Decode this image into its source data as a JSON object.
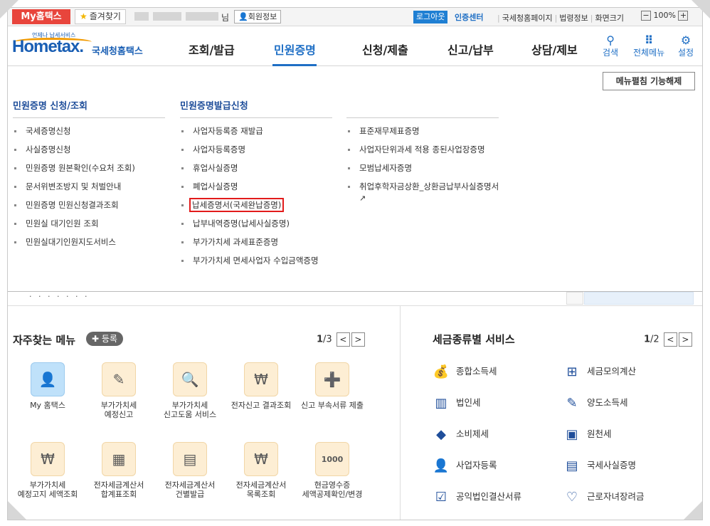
{
  "topbar": {
    "myhome": "My홈택스",
    "favorites": "즐겨찾기",
    "user_suffix": "님",
    "member_info": "회원정보",
    "logout": "로그아웃",
    "cert_center": "인증센터",
    "links": [
      "국세청홈페이지",
      "법령정보",
      "화면크기"
    ],
    "zoom_minus": "−",
    "zoom": "100%",
    "zoom_plus": "+"
  },
  "logo": {
    "small": "언제나 납세서비스",
    "home": "Hom",
    "e": "e",
    "tax": "tax.",
    "name": "국세청홈택스"
  },
  "gnb": [
    "조회/발급",
    "민원증명",
    "신청/제출",
    "신고/납부",
    "상담/제보"
  ],
  "header_icons": [
    {
      "label": "검색",
      "icon": "search-icon",
      "glyph": "🔍"
    },
    {
      "label": "전체메뉴",
      "icon": "grid-icon",
      "glyph": "⠿"
    },
    {
      "label": "설정",
      "icon": "gear-icon",
      "glyph": "⚙"
    }
  ],
  "menu_mode_button": "메뉴펼침 기능해제",
  "mega": {
    "col1": {
      "title": "민원증명 신청/조회",
      "items": [
        "국세증명신청",
        "사실증명신청",
        "민원증명 원본확인(수요처 조회)",
        "문서위변조방지 및 처벌안내",
        "민원증명 민원신청결과조회",
        "민원실 대기인원 조회",
        "민원실대기인원지도서비스"
      ]
    },
    "col2": {
      "title": "민원증명발급신청",
      "items": [
        "사업자등록증 재발급",
        "사업자등록증명",
        "휴업사실증명",
        "폐업사실증명",
        "납세증명서(국세완납증명)",
        "납부내역증명(납세사실증명)",
        "부가가치세 과세표준증명",
        "부가가치세 면세사업자 수입금액증명"
      ]
    },
    "col3": {
      "items": [
        "표준재무제표증명",
        "사업자단위과세 적용 종된사업장증명",
        "모범납세자증명",
        "취업후학자금상환_상환금납부사실증명서"
      ]
    }
  },
  "frequent": {
    "title": "자주찾는 메뉴",
    "register": "등록",
    "page_current": "1",
    "page_total": "/3",
    "prev": "<",
    "next": ">",
    "tiles": [
      {
        "line1": "My 홈택스",
        "line2": "",
        "icon": "user-icon",
        "glyph": "👤"
      },
      {
        "line1": "부가가치세",
        "line2": "예정신고",
        "icon": "vat-edit-icon",
        "glyph": "✎"
      },
      {
        "line1": "부가가치세",
        "line2": "신고도움 서비스",
        "icon": "document-search-icon",
        "glyph": "🔍"
      },
      {
        "line1": "전자신고 결과조회",
        "line2": "",
        "icon": "won-search-icon",
        "glyph": "₩"
      },
      {
        "line1": "신고 부속서류 제출",
        "line2": "",
        "icon": "document-add-icon",
        "glyph": "➕"
      },
      {
        "line1": "부가가치세",
        "line2": "예정고지 세액조회",
        "icon": "won-search-icon",
        "glyph": "₩"
      },
      {
        "line1": "전자세금계산서",
        "line2": "합계표조회",
        "icon": "sheet-plus-icon",
        "glyph": "▦"
      },
      {
        "line1": "전자세금계산서",
        "line2": "건별발급",
        "icon": "calculator-icon",
        "glyph": "▤"
      },
      {
        "line1": "전자세금계산서",
        "line2": "목록조회",
        "icon": "won-search-icon",
        "glyph": "₩"
      },
      {
        "line1": "현금영수증",
        "line2": "세액공제확인/변경",
        "icon": "cash-search-icon",
        "glyph": "1000"
      }
    ]
  },
  "services": {
    "title": "세금종류별 서비스",
    "page_current": "1",
    "page_total": "/2",
    "prev": "<",
    "next": ">",
    "items": [
      {
        "label": "종합소득세",
        "icon": "money-bag-icon",
        "glyph": "💰"
      },
      {
        "label": "세금모의계산",
        "icon": "calculator-icon",
        "glyph": "⊞"
      },
      {
        "label": "법인세",
        "icon": "building-icon",
        "glyph": "▥"
      },
      {
        "label": "양도소득세",
        "icon": "document-edit-icon",
        "glyph": "✎"
      },
      {
        "label": "소비제세",
        "icon": "diamond-icon",
        "glyph": "◆"
      },
      {
        "label": "원천세",
        "icon": "salary-doc-icon",
        "glyph": "▣"
      },
      {
        "label": "사업자등록",
        "icon": "person-icon",
        "glyph": "👤"
      },
      {
        "label": "국세사실증명",
        "icon": "document-icon",
        "glyph": "▤"
      },
      {
        "label": "공익법인결산서류",
        "icon": "clipboard-check-icon",
        "glyph": "☑"
      },
      {
        "label": "근로자녀장려금",
        "icon": "heart-hand-icon",
        "glyph": "♡"
      }
    ]
  }
}
